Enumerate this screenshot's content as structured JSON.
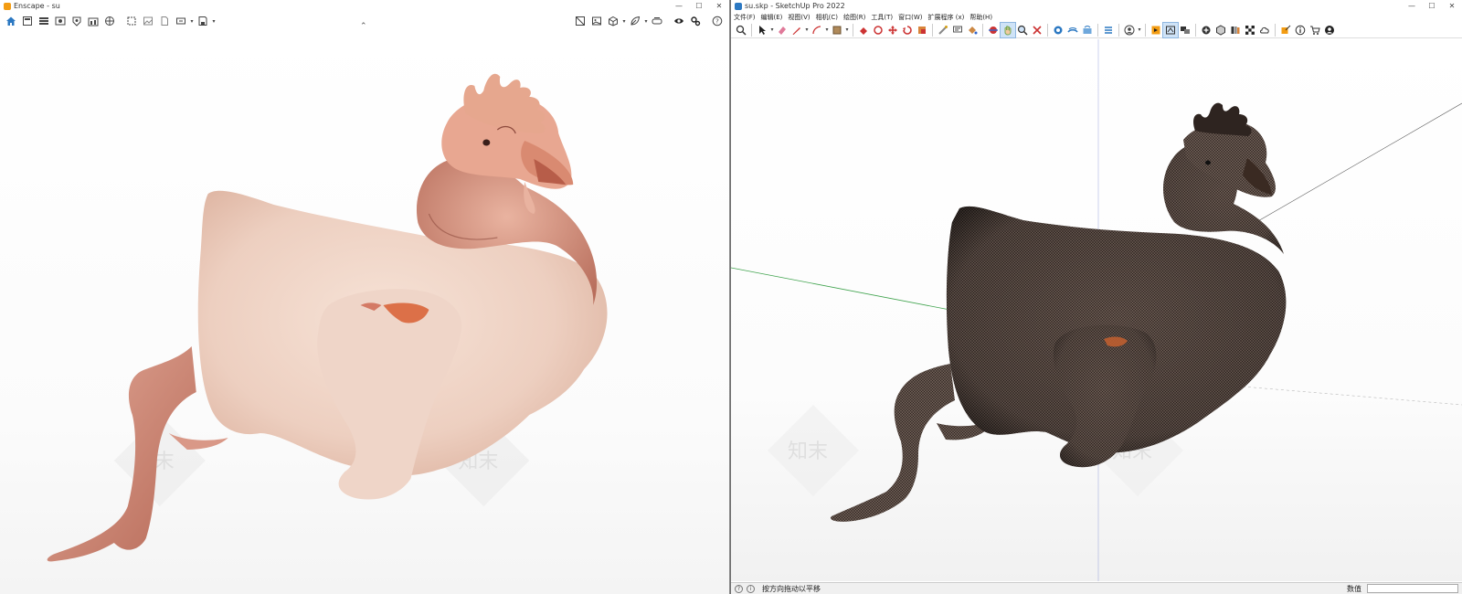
{
  "enscape": {
    "title": "Enscape - su",
    "accent": "#f39c12",
    "toolbar_left": [
      "home-icon",
      "save-view-icon",
      "batch-render-icon",
      "video-editor-icon",
      "panorama-icon",
      "web-standalone-icon",
      "screenshot-icon",
      "image-icon",
      "document-icon",
      "export-icon",
      "save-dropdown-icon"
    ],
    "toolbar_right": [
      "asset-library-icon",
      "materials-icon",
      "cube-view-icon",
      "leaf-icon",
      "vr-headset-icon",
      "eye-visual-settings-icon",
      "gear-settings-icon",
      "help-icon"
    ]
  },
  "sketchup": {
    "title": "su.skp - SketchUp Pro 2022",
    "accent": "#2b78c2",
    "menu": [
      "文件(F)",
      "编辑(E)",
      "视图(V)",
      "相机(C)",
      "绘图(R)",
      "工具(T)",
      "窗口(W)",
      "扩展程序 (x)",
      "帮助(H)"
    ],
    "status_message": "按方向拖动以平移",
    "vcb_label": "数值",
    "axis_colors": {
      "green": "#3fa34d",
      "blue": "#5a6cc8",
      "red": "#c44"
    }
  },
  "watermark_text": "知末",
  "window_controls": [
    "—",
    "☐",
    "✕"
  ]
}
